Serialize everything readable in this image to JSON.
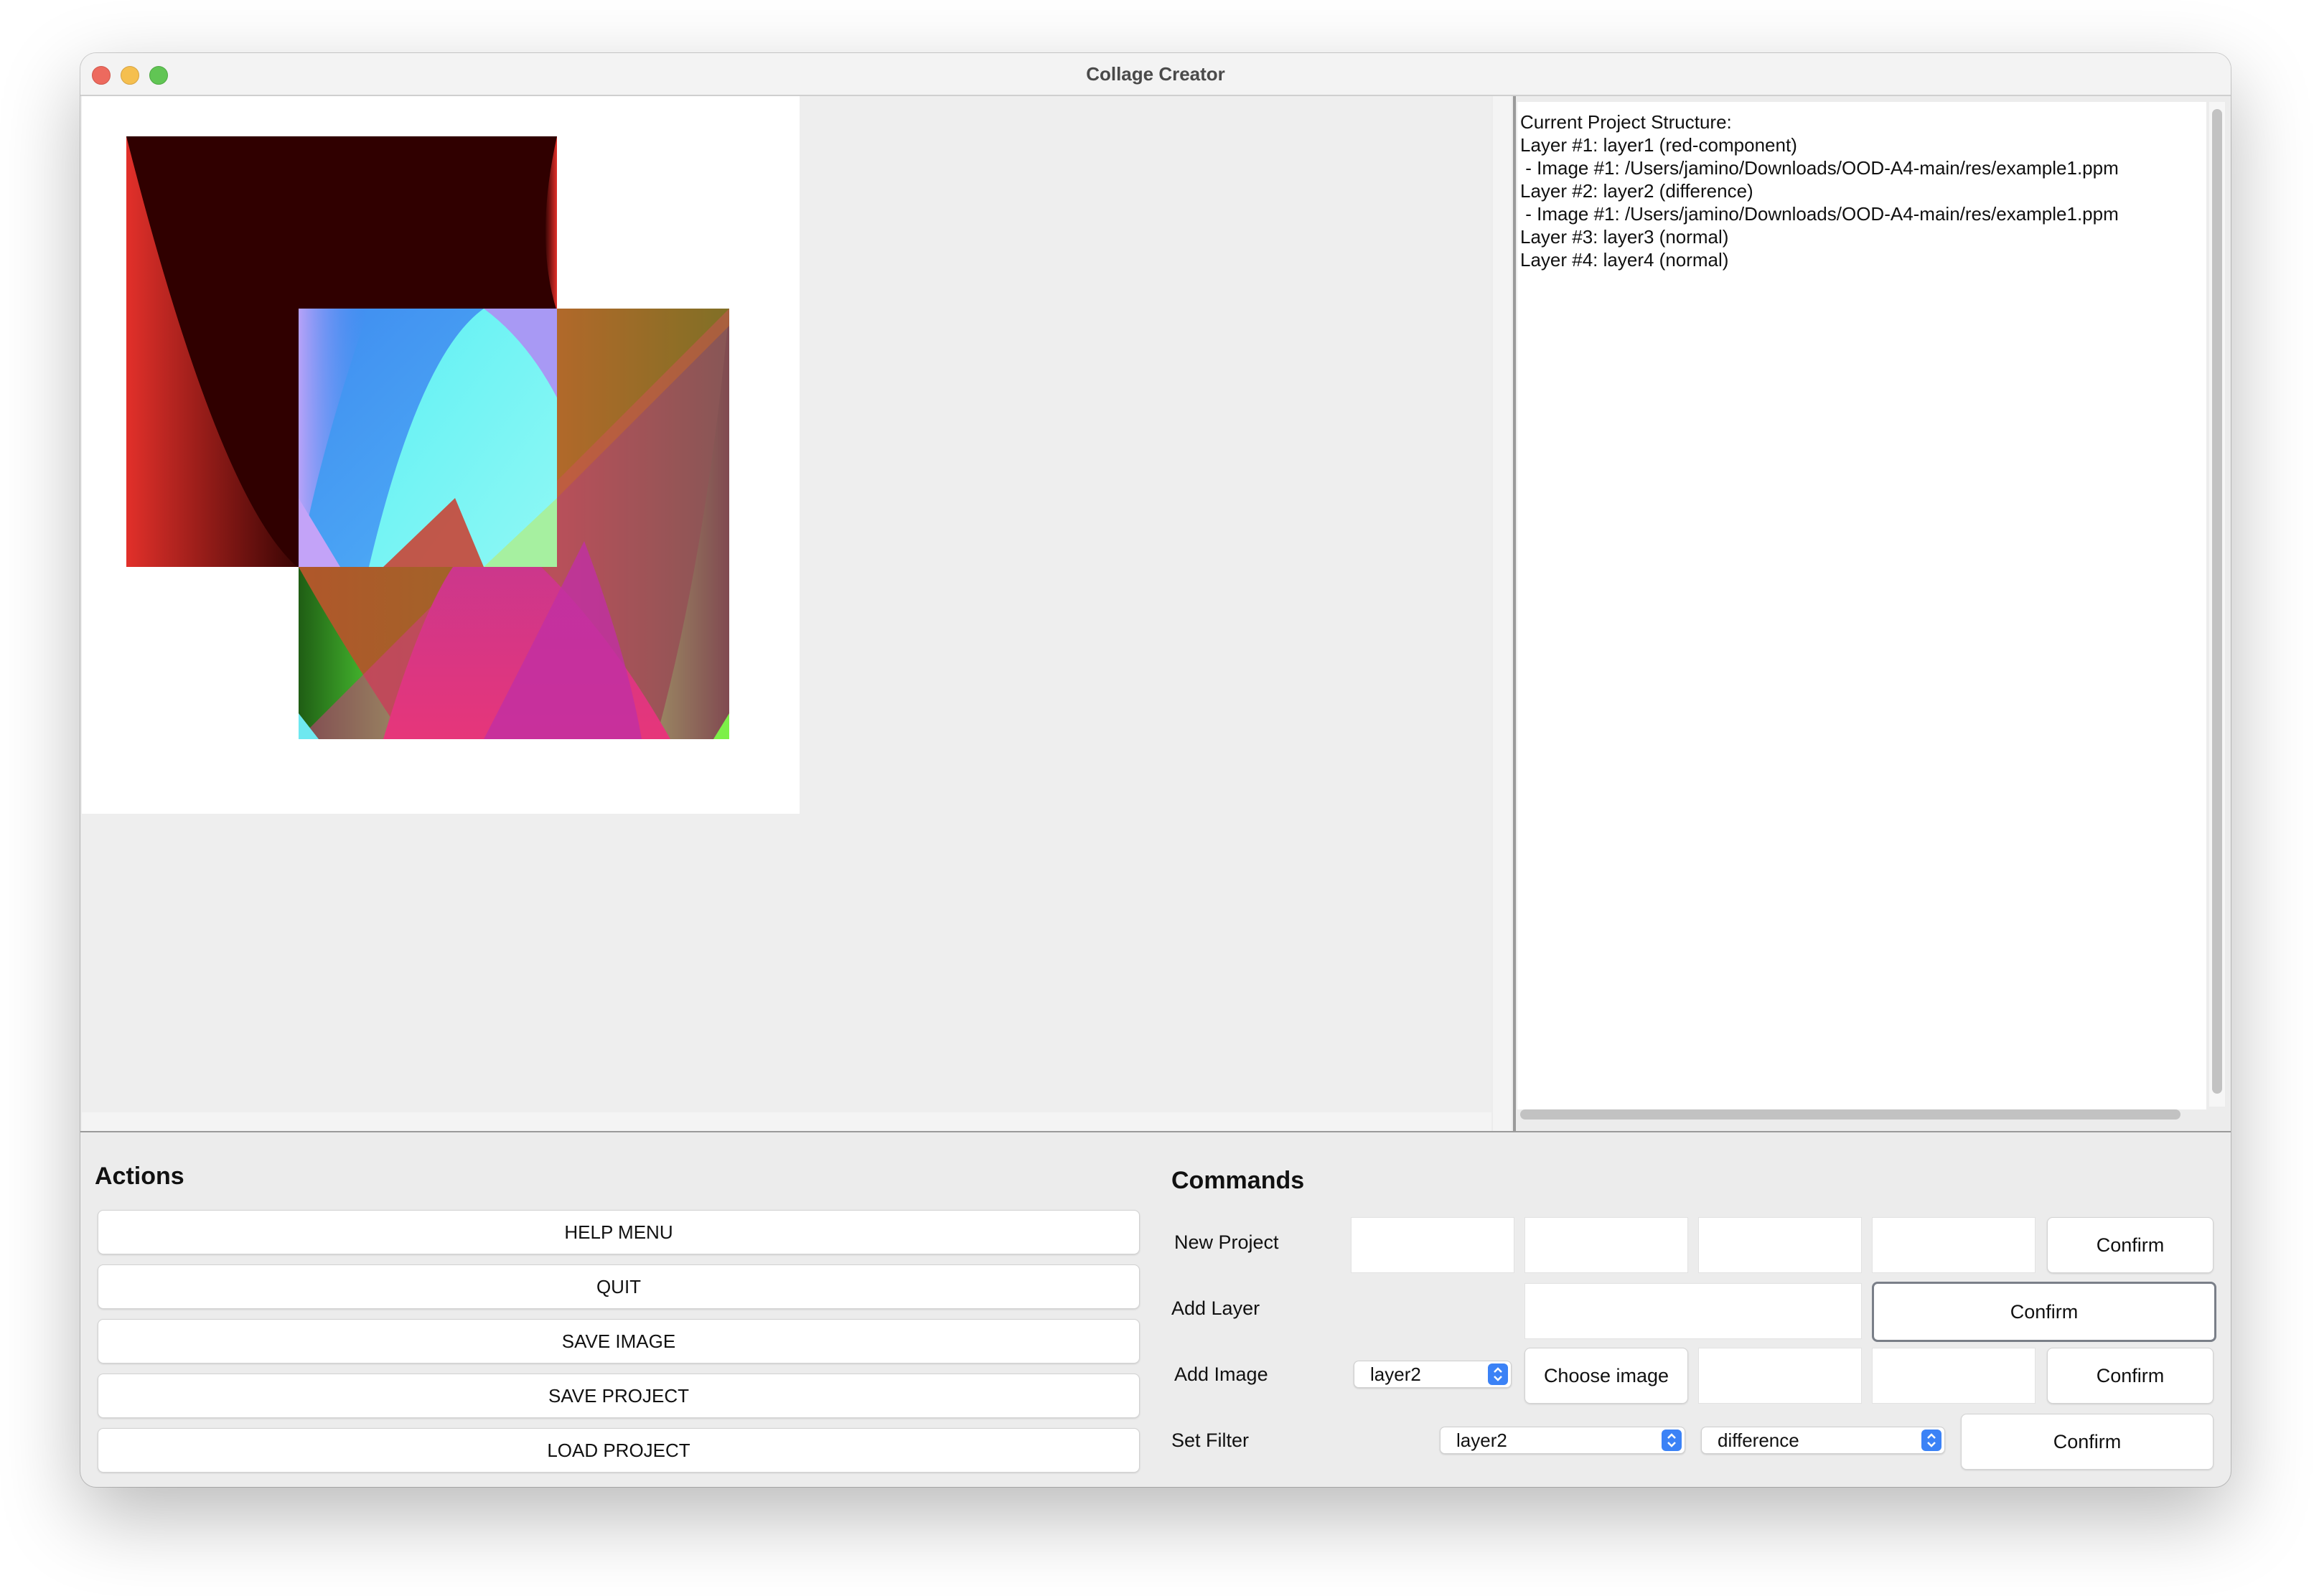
{
  "window": {
    "title": "Collage Creator"
  },
  "structure": {
    "lines": [
      "Current Project Structure:",
      "Layer #1: layer1 (red-component)",
      " - Image #1: /Users/jamino/Downloads/OOD-A4-main/res/example1.ppm",
      "Layer #2: layer2 (difference)",
      " - Image #1: /Users/jamino/Downloads/OOD-A4-main/res/example1.ppm",
      "Layer #3: layer3 (normal)",
      "Layer #4: layer4 (normal)"
    ]
  },
  "actions": {
    "title": "Actions",
    "buttons": [
      "HELP MENU",
      "QUIT",
      "SAVE IMAGE",
      "SAVE PROJECT",
      "LOAD PROJECT"
    ]
  },
  "commands": {
    "title": "Commands",
    "new_project": {
      "label": "New Project",
      "confirm": "Confirm"
    },
    "add_layer": {
      "label": "Add Layer",
      "confirm": "Confirm"
    },
    "add_image": {
      "label": "Add Image",
      "layer_value": "layer2",
      "choose": "Choose image",
      "confirm": "Confirm"
    },
    "set_filter": {
      "label": "Set Filter",
      "layer_value": "layer2",
      "filter_value": "difference",
      "confirm": "Confirm"
    }
  },
  "icons": {
    "combo_arrow": "chevron-updown-icon",
    "close": "close-icon",
    "minimize": "minimize-icon",
    "zoom": "zoom-icon"
  },
  "colors": {
    "combo_accent": "#3b82f6",
    "window_bg": "#ececec"
  }
}
